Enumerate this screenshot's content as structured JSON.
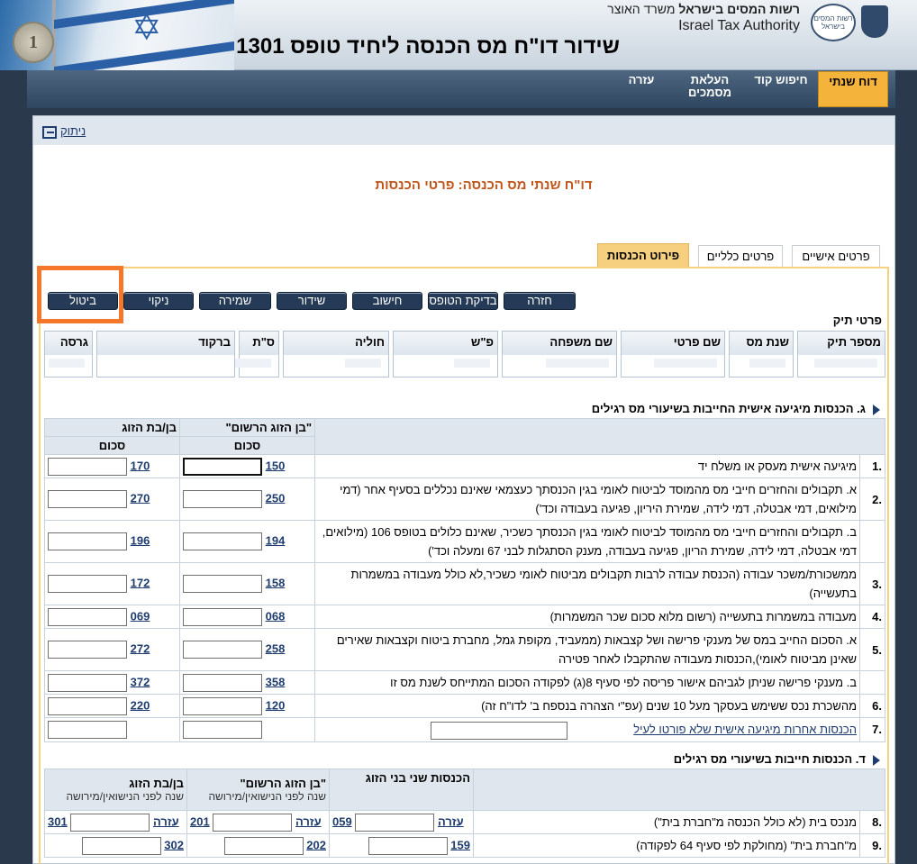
{
  "header": {
    "authority_he_bold": "רשות המסים בישראל",
    "authority_he_rest": "משרד האוצר",
    "authority_en": "Israel Tax Authority",
    "logo_text": "רשות המסים בישראל",
    "title": "שידור דו\"ח מס הכנסה ליחיד טופס 1301",
    "coin": "1"
  },
  "nav": {
    "annual_report": "דוח שנתי",
    "code_search": "חיפוש קוד",
    "upload_docs_1": "העלאת",
    "upload_docs_2": "מסמכים",
    "help": "עזרה"
  },
  "subbar": {
    "logout": "ניתוק"
  },
  "report_title": "דו\"ח שנתי מס הכנסה: פרטי הכנסות",
  "tabs": {
    "personal": "פרטים אישיים",
    "general": "פרטים כלליים",
    "income": "פירוט הכנסות"
  },
  "buttons": {
    "back": "חזרה",
    "check_form": "בדיקת הטופס",
    "calculate": "חישוב",
    "transmit": "שידור",
    "save": "שמירה",
    "clear": "ניקוי",
    "cancel": "ביטול"
  },
  "file_details": {
    "label": "פרטי תיק",
    "cols": [
      "מספר תיק",
      "שנת מס",
      "שם פרטי",
      "שם משפחה",
      "פ\"ש",
      "חוליה",
      "ס\"ת",
      "ברקוד",
      "גרסה"
    ]
  },
  "section_g": {
    "title": "ג. הכנסות מיגיעה אישית החייבות בשיעורי מס רגילים",
    "col_registered": "\"בן הזוג הרשום\"",
    "col_spouse": "בן/בת הזוג",
    "col_sum": "סכום",
    "rows": [
      {
        "num": "1.",
        "desc": "מיגיעה אישית מעסק או משלח יד",
        "code1": "150",
        "code2": "170"
      },
      {
        "num": "2.",
        "desc": "א. תקבולים והחזרים חייבי מס מהמוסד לביטוח לאומי בגין הכנסתך כעצמאי שאינם נכללים בסעיף אחר (דמי מילואים, דמי אבטלה, דמי לידה, שמירת היריון, פגיעה בעבודה וכד')",
        "code1": "250",
        "code2": "270"
      },
      {
        "num": "",
        "desc": "ב. תקבולים והחזרים חייבי מס מהמוסד לביטוח לאומי בגין הכנסתך כשכיר, שאינם כלולים בטופס 106 (מילואים, דמי אבטלה, דמי לידה, שמירת הריון, פגיעה בעבודה, מענק הסתגלות לבני 67 ומעלה וכד')",
        "code1": "194",
        "code2": "196"
      },
      {
        "num": "3.",
        "desc": "ממשכורת/משכר עבודה (הכנסת עבודה לרבות תקבולים מביטוח לאומי כשכיר,לא כולל מעבודה במשמרות בתעשייה)",
        "code1": "158",
        "code2": "172"
      },
      {
        "num": "4.",
        "desc": "מעבודה במשמרות בתעשייה (רשום מלוא סכום שכר המשמרות)",
        "code1": "068",
        "code2": "069"
      },
      {
        "num": "5.",
        "desc": "א. הסכום החייב במס של מענקי פרישה ושל קצבאות (ממעביד, מקופת גמל, מחברת ביטוח וקצבאות שאירים שאינן מביטוח לאומי),הכנסות מעבודה שהתקבלו לאחר פטירה",
        "code1": "258",
        "code2": "272"
      },
      {
        "num": "",
        "desc": "ב. מענקי פרישה שניתן לגביהם אישור פריסה לפי סעיף 8(ג) לפקודה הסכום המתייחס לשנת מס זו",
        "code1": "358",
        "code2": "372"
      },
      {
        "num": "6.",
        "desc": "מהשכרת נכס ששימש בעסקך מעל 10 שנים (עפ\"י הצהרה בנספח ב' לדו\"ח זה)",
        "code1": "120",
        "code2": "220"
      },
      {
        "num": "7.",
        "desc": "הכנסות אחרות מיגיעה אישית שלא פורטו לעיל",
        "code1": "",
        "code2": ""
      }
    ]
  },
  "section_d": {
    "title": "ד. הכנסות חייבות בשיעורי מס רגילים",
    "col_both": "הכנסות שני בני הזוג",
    "col_registered": "\"בן הזוג הרשום\"",
    "col_spouse": "בן/בת הזוג",
    "col_sub": "שנה לפני הנישואין/מירושה",
    "help": "עזרה",
    "rows": [
      {
        "num": "8.",
        "desc": "מנכס בית (לא כולל הכנסה מ\"חברת בית\")",
        "code0": "059",
        "code1": "201",
        "code2": "301"
      },
      {
        "num": "9.",
        "desc": "מ\"חברת בית\" (מחולקת לפי סעיף 64 לפקודה)",
        "code0": "159",
        "code1": "202",
        "code2": "302"
      }
    ]
  }
}
